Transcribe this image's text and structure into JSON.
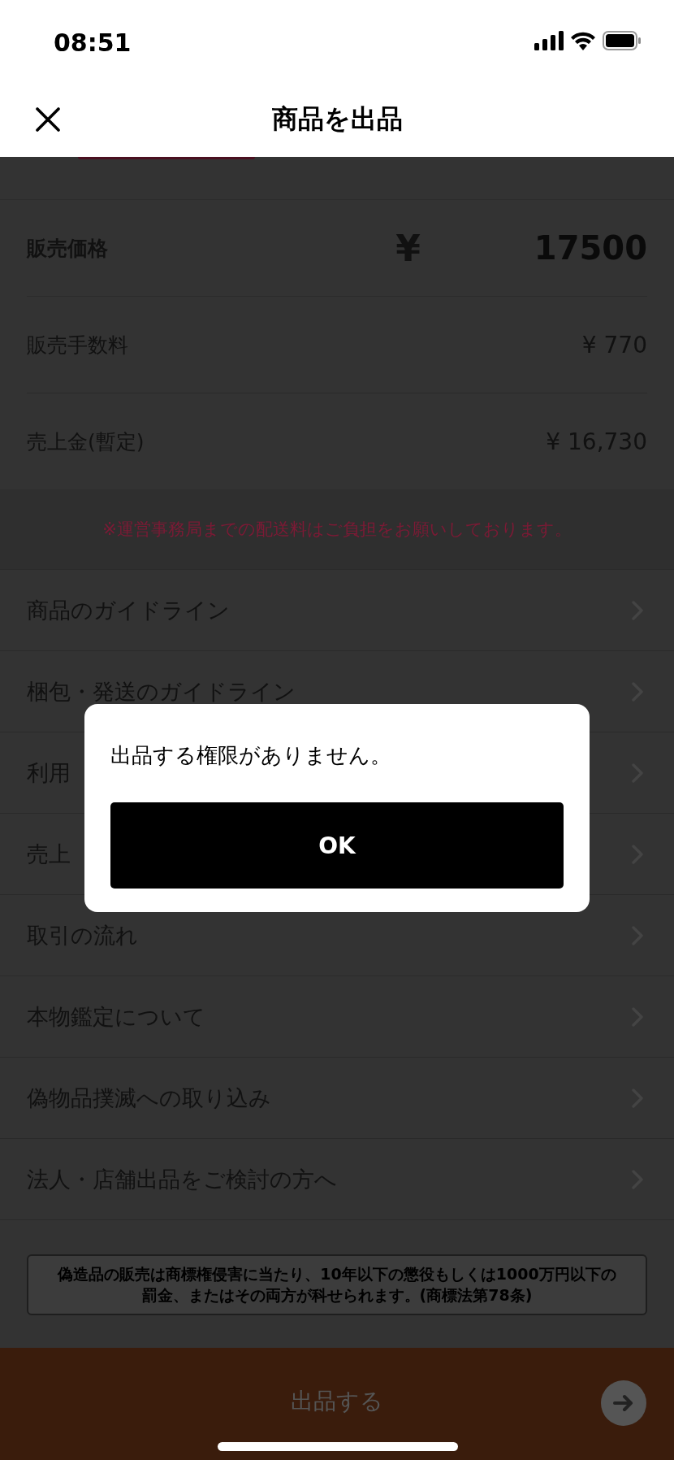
{
  "status_bar": {
    "time": "08:51"
  },
  "header": {
    "title": "商品を出品"
  },
  "price": {
    "label": "販売価格",
    "currency": "¥",
    "value": "17500"
  },
  "summary_rows": [
    {
      "label": "販売手数料",
      "value": "¥ 770"
    },
    {
      "label": "売上金(暫定)",
      "value": "¥ 16,730"
    }
  ],
  "notice": "※運営事務局までの配送料はご負担をお願いしております。",
  "links": [
    {
      "label": "商品のガイドライン"
    },
    {
      "label": "梱包・発送のガイドライン"
    },
    {
      "label": "利用"
    },
    {
      "label": "売上"
    },
    {
      "label": "取引の流れ"
    },
    {
      "label": "本物鑑定について"
    },
    {
      "label": "偽物品撲滅への取り込み"
    },
    {
      "label": "法人・店舗出品をご検討の方へ"
    }
  ],
  "disclaimer": "偽造品の販売は商標権侵害に当たり、10年以下の懲役もしくは1000万円以下の罰金、またはその両方が科せられます。(商標法第78条)",
  "submit_button": {
    "label": "出品する",
    "disabled": true
  },
  "dialog": {
    "message": "出品する権限がありません。",
    "button": "OK"
  }
}
